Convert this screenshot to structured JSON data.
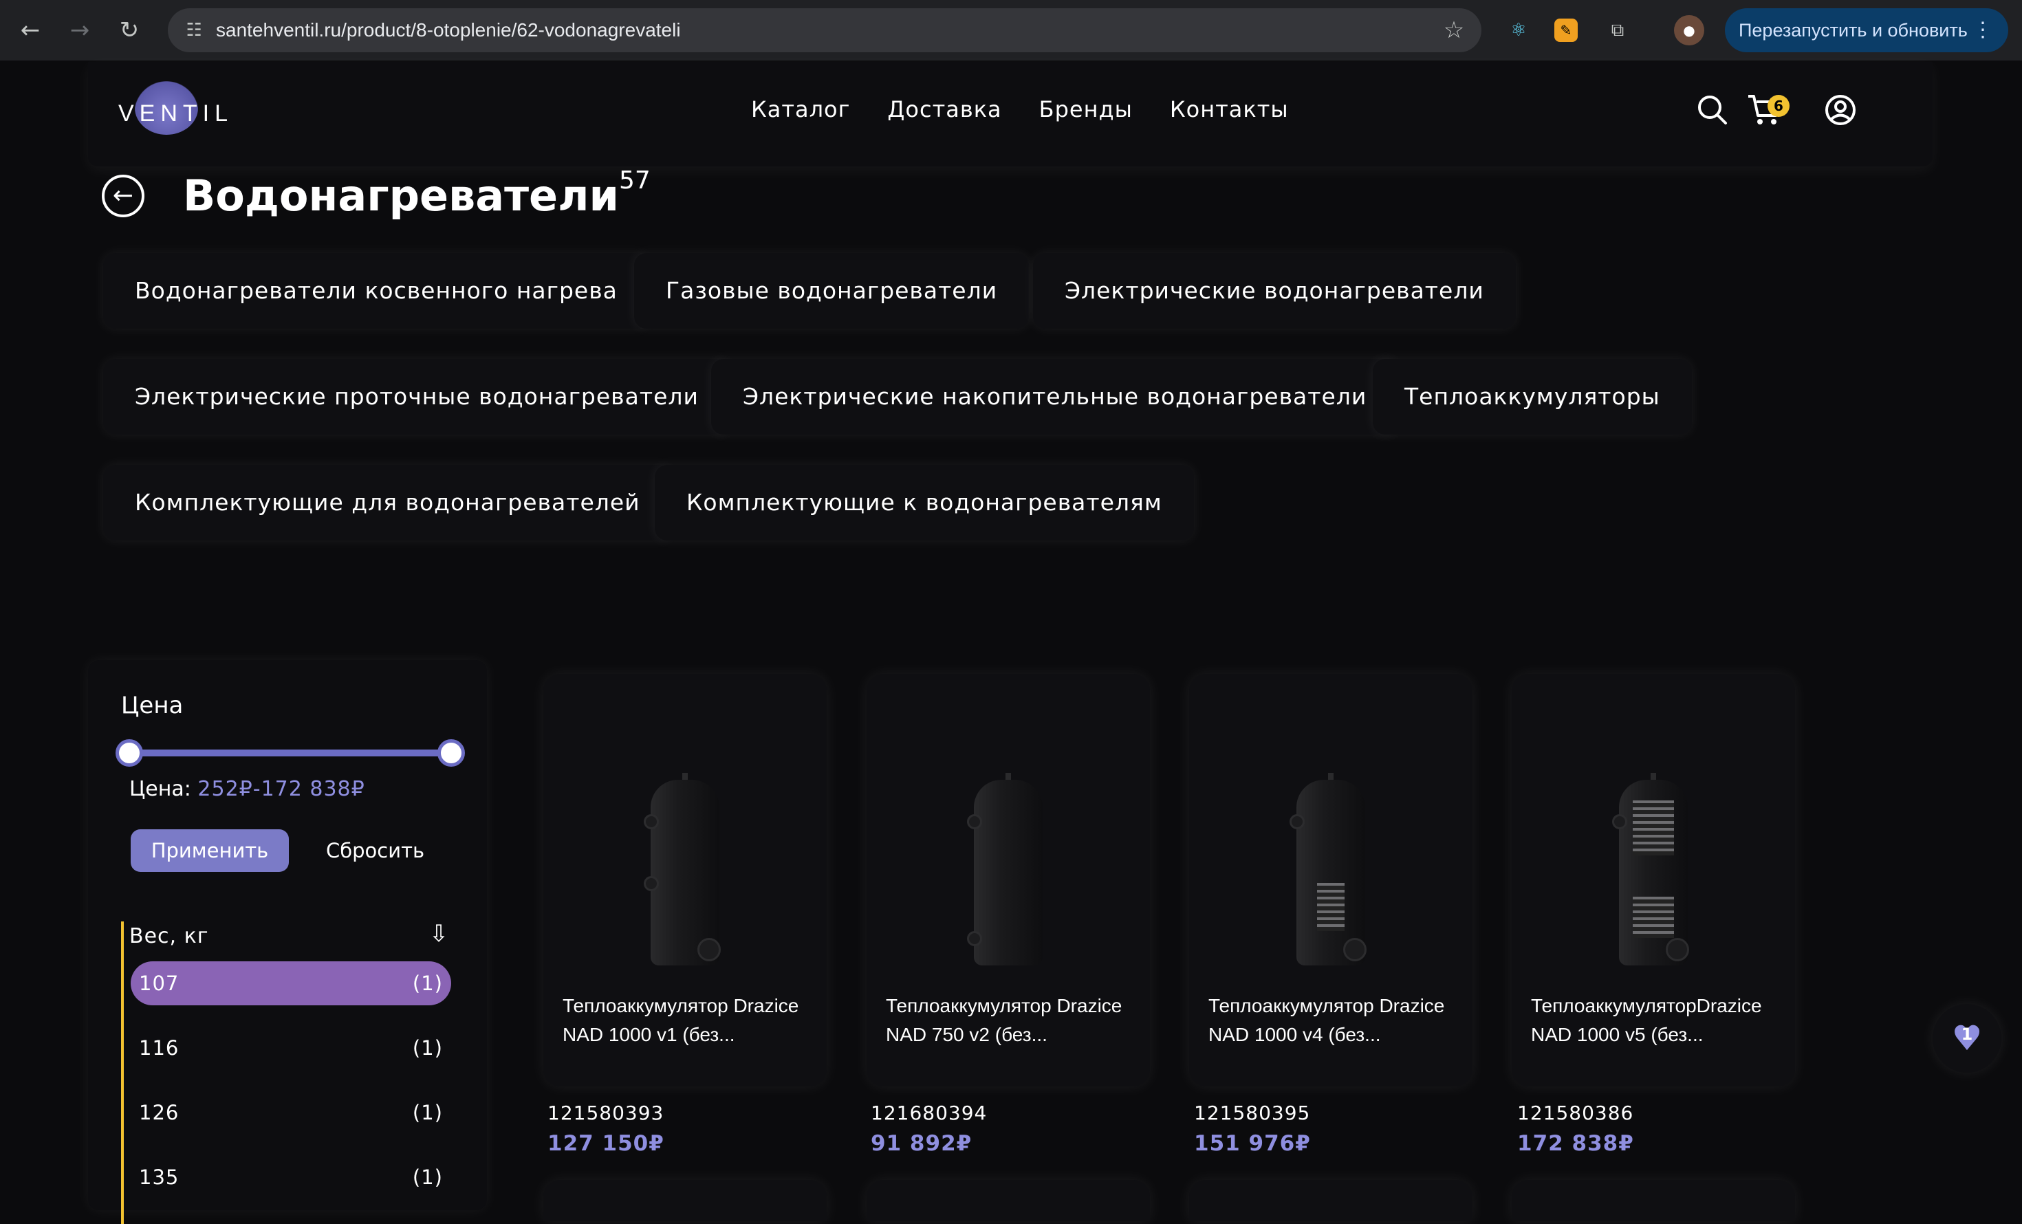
{
  "browser": {
    "url": "santehventil.ru/product/8-otoplenie/62-vodonagrevateli",
    "relaunch_label": "Перезапустить и обновить"
  },
  "header": {
    "logo_text": "VENTIL",
    "nav": [
      "Каталог",
      "Доставка",
      "Бренды",
      "Контакты"
    ],
    "cart_count": "6"
  },
  "page": {
    "title": "Водонагреватели",
    "count": "57"
  },
  "categories": [
    "Водонагреватели косвенного нагрева",
    "Газовые водонагреватели",
    "Электрические водонагреватели",
    "Электрические проточные водонагреватели",
    "Электрические накопительные водонагреватели",
    "Теплоаккумуляторы",
    "Комплектующие для водонагревателей",
    "Комплектующие к водонагревателям"
  ],
  "filters": {
    "price_title": "Цена",
    "price_label": "Цена:",
    "price_values": "252₽-172 838₽",
    "apply_label": "Применить",
    "reset_label": "Сбросить",
    "weight_title": "Вес, кг",
    "weights": [
      {
        "value": "107",
        "count": "(1)",
        "active": true
      },
      {
        "value": "116",
        "count": "(1)",
        "active": false
      },
      {
        "value": "126",
        "count": "(1)",
        "active": false
      },
      {
        "value": "135",
        "count": "(1)",
        "active": false
      }
    ]
  },
  "products": [
    {
      "name": "Теплоаккумулятор Drazice NAD 1000 v1 (без...",
      "sku": "121580393",
      "price": "127 150₽"
    },
    {
      "name": "Теплоаккумулятор Drazice NAD 750 v2 (без...",
      "sku": "121680394",
      "price": "91 892₽"
    },
    {
      "name": "Теплоаккумулятор Drazice NAD 1000 v4 (без...",
      "sku": "121580395",
      "price": "151 976₽"
    },
    {
      "name": "ТеплоаккумуляторDrazice NAD 1000 v5 (без...",
      "sku": "121580386",
      "price": "172 838₽"
    }
  ],
  "favorites_count": "1",
  "colors": {
    "accent": "#7b7bc7",
    "price": "#8f8fe0",
    "badge": "#f2c230",
    "active_filter": "#8a64b5"
  }
}
